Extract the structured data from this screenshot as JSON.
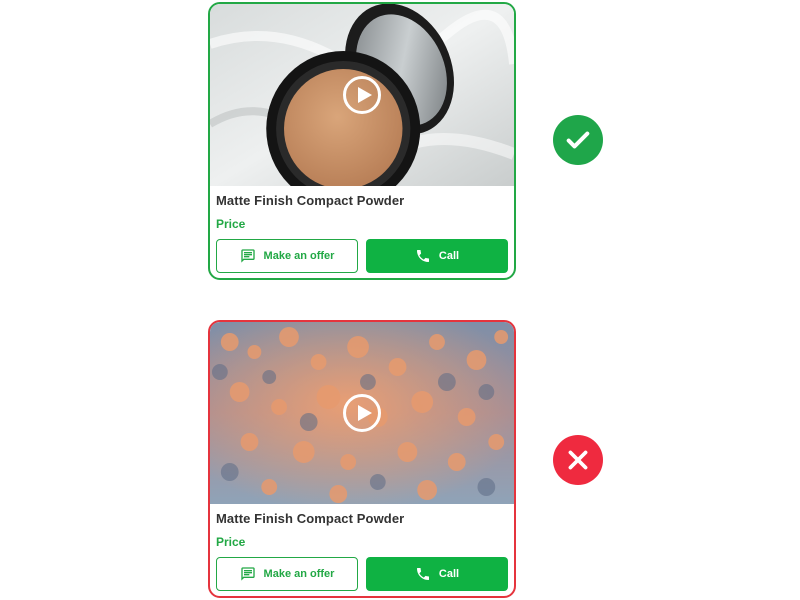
{
  "colors": {
    "good": "#22a845",
    "bad": "#e5343d",
    "call_bg": "#0fb243",
    "check_bg": "#1fa64a",
    "cross_bg": "#ef2a3f"
  },
  "cards": [
    {
      "variant": "good",
      "media_icon": "play-icon",
      "title": "Matte Finish Compact Powder",
      "price_label": "Price",
      "offer_label": "Make an offer",
      "call_label": "Call",
      "offer_icon": "message-icon",
      "call_icon": "phone-icon"
    },
    {
      "variant": "bad",
      "media_icon": "play-icon",
      "title": "Matte Finish Compact Powder",
      "price_label": "Price",
      "offer_label": "Make an offer",
      "call_label": "Call",
      "offer_icon": "message-icon",
      "call_icon": "phone-icon"
    }
  ],
  "indicators": {
    "good": "check-icon",
    "bad": "cross-icon"
  }
}
